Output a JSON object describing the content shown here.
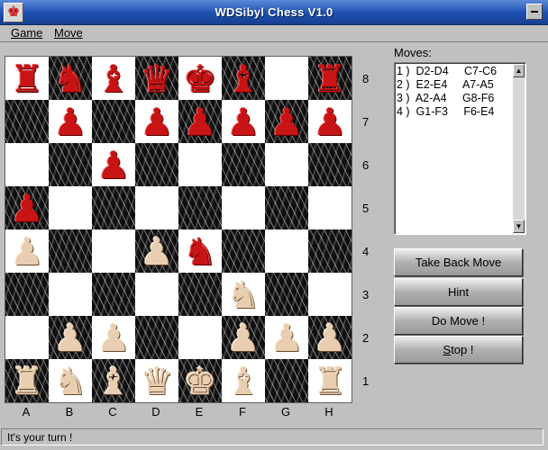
{
  "window": {
    "title": "WDSibyl Chess V1.0",
    "icon": "chess-king-icon"
  },
  "menu": [
    {
      "label": "Game",
      "id": "game"
    },
    {
      "label": "Move",
      "id": "move"
    }
  ],
  "board": {
    "files": [
      "A",
      "B",
      "C",
      "D",
      "E",
      "F",
      "G",
      "H"
    ],
    "ranks": [
      "8",
      "7",
      "6",
      "5",
      "4",
      "3",
      "2",
      "1"
    ],
    "light_color": "#ffffff",
    "dark_color": "#1a1a1a",
    "black_piece_color": "#c81414",
    "white_piece_color": "#e9cfb1",
    "pieces": [
      {
        "square": "a8",
        "type": "rook",
        "color": "black"
      },
      {
        "square": "b8",
        "type": "knight",
        "color": "black"
      },
      {
        "square": "c8",
        "type": "bishop",
        "color": "black"
      },
      {
        "square": "d8",
        "type": "queen",
        "color": "black"
      },
      {
        "square": "e8",
        "type": "king",
        "color": "black"
      },
      {
        "square": "f8",
        "type": "bishop",
        "color": "black"
      },
      {
        "square": "h8",
        "type": "rook",
        "color": "black"
      },
      {
        "square": "b7",
        "type": "pawn",
        "color": "black"
      },
      {
        "square": "d7",
        "type": "pawn",
        "color": "black"
      },
      {
        "square": "e7",
        "type": "pawn",
        "color": "black"
      },
      {
        "square": "f7",
        "type": "pawn",
        "color": "black"
      },
      {
        "square": "g7",
        "type": "pawn",
        "color": "black"
      },
      {
        "square": "h7",
        "type": "pawn",
        "color": "black"
      },
      {
        "square": "c6",
        "type": "pawn",
        "color": "black"
      },
      {
        "square": "a5",
        "type": "pawn",
        "color": "black"
      },
      {
        "square": "e4",
        "type": "knight",
        "color": "black"
      },
      {
        "square": "a4",
        "type": "pawn",
        "color": "white"
      },
      {
        "square": "d4",
        "type": "pawn",
        "color": "white"
      },
      {
        "square": "f3",
        "type": "knight",
        "color": "white"
      },
      {
        "square": "b2",
        "type": "pawn",
        "color": "white"
      },
      {
        "square": "c2",
        "type": "pawn",
        "color": "white"
      },
      {
        "square": "f2",
        "type": "pawn",
        "color": "white"
      },
      {
        "square": "g2",
        "type": "pawn",
        "color": "white"
      },
      {
        "square": "h2",
        "type": "pawn",
        "color": "white"
      },
      {
        "square": "a1",
        "type": "rook",
        "color": "white"
      },
      {
        "square": "b1",
        "type": "knight",
        "color": "white"
      },
      {
        "square": "c1",
        "type": "bishop",
        "color": "white"
      },
      {
        "square": "d1",
        "type": "queen",
        "color": "white"
      },
      {
        "square": "e1",
        "type": "king",
        "color": "white"
      },
      {
        "square": "f1",
        "type": "bishop",
        "color": "white"
      },
      {
        "square": "h1",
        "type": "rook",
        "color": "white"
      }
    ]
  },
  "moves": {
    "label": "Moves:",
    "entries": [
      "1 )  D2-D4     C7-C6",
      "2 )  E2-E4     A7-A5",
      "3 )  A2-A4     G8-F6",
      "4 )  G1-F3     F6-E4"
    ]
  },
  "buttons": {
    "take_back": "Take Back Move",
    "hint": "Hint",
    "do_move": "Do Move !",
    "stop_underlined": "S",
    "stop_rest": "top !"
  },
  "status": "It's your turn !"
}
